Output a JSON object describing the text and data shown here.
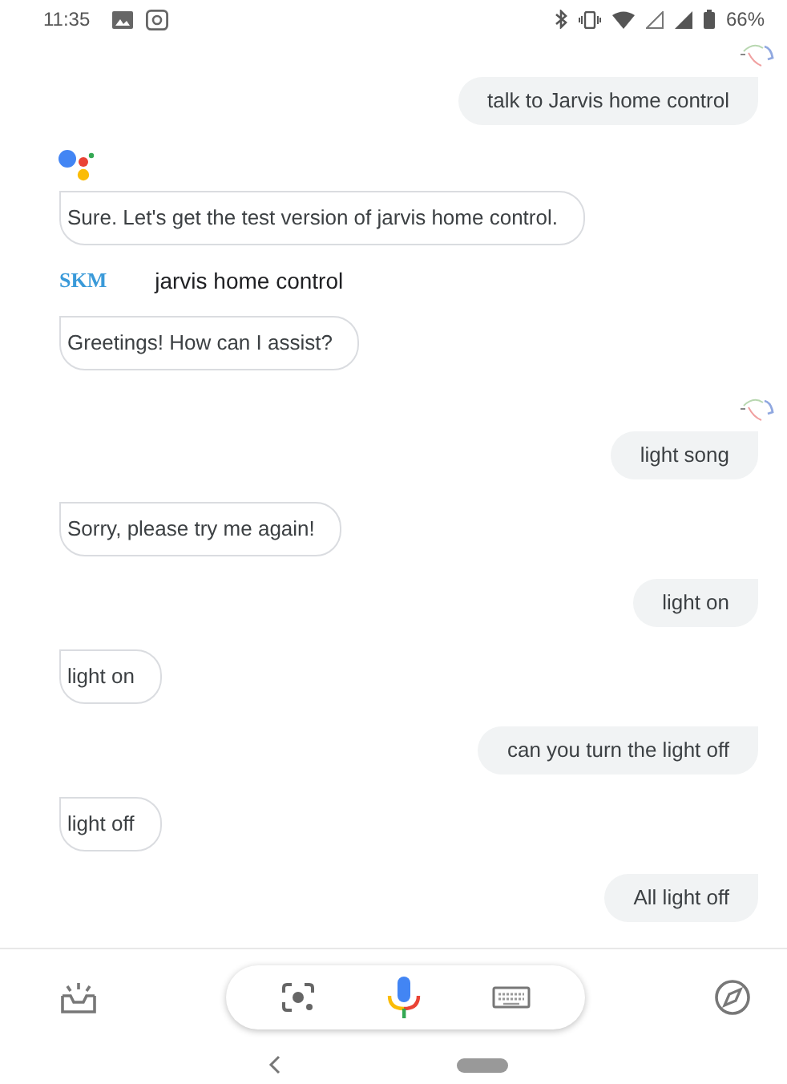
{
  "status_bar": {
    "time": "11:35",
    "battery": "66%"
  },
  "messages": [
    {
      "kind": "user",
      "avatar": true,
      "text": "talk to Jarvis home control"
    },
    {
      "kind": "assistant",
      "avatar": true,
      "text": "Sure. Let's get the test version of jarvis home control."
    },
    {
      "kind": "app",
      "logo": "SKM",
      "text": "jarvis home control"
    },
    {
      "kind": "assistant",
      "avatar": false,
      "text": "Greetings! How can I assist?"
    },
    {
      "kind": "user",
      "avatar": true,
      "text": "light song"
    },
    {
      "kind": "assistant",
      "avatar": false,
      "text": "Sorry, please try me again!"
    },
    {
      "kind": "user",
      "avatar": false,
      "text": "light on"
    },
    {
      "kind": "assistant",
      "avatar": false,
      "text": "light on"
    },
    {
      "kind": "user",
      "avatar": false,
      "text": "can you turn the light off"
    },
    {
      "kind": "assistant",
      "avatar": false,
      "text": "light off"
    },
    {
      "kind": "user",
      "avatar": false,
      "text": "All light off"
    }
  ]
}
